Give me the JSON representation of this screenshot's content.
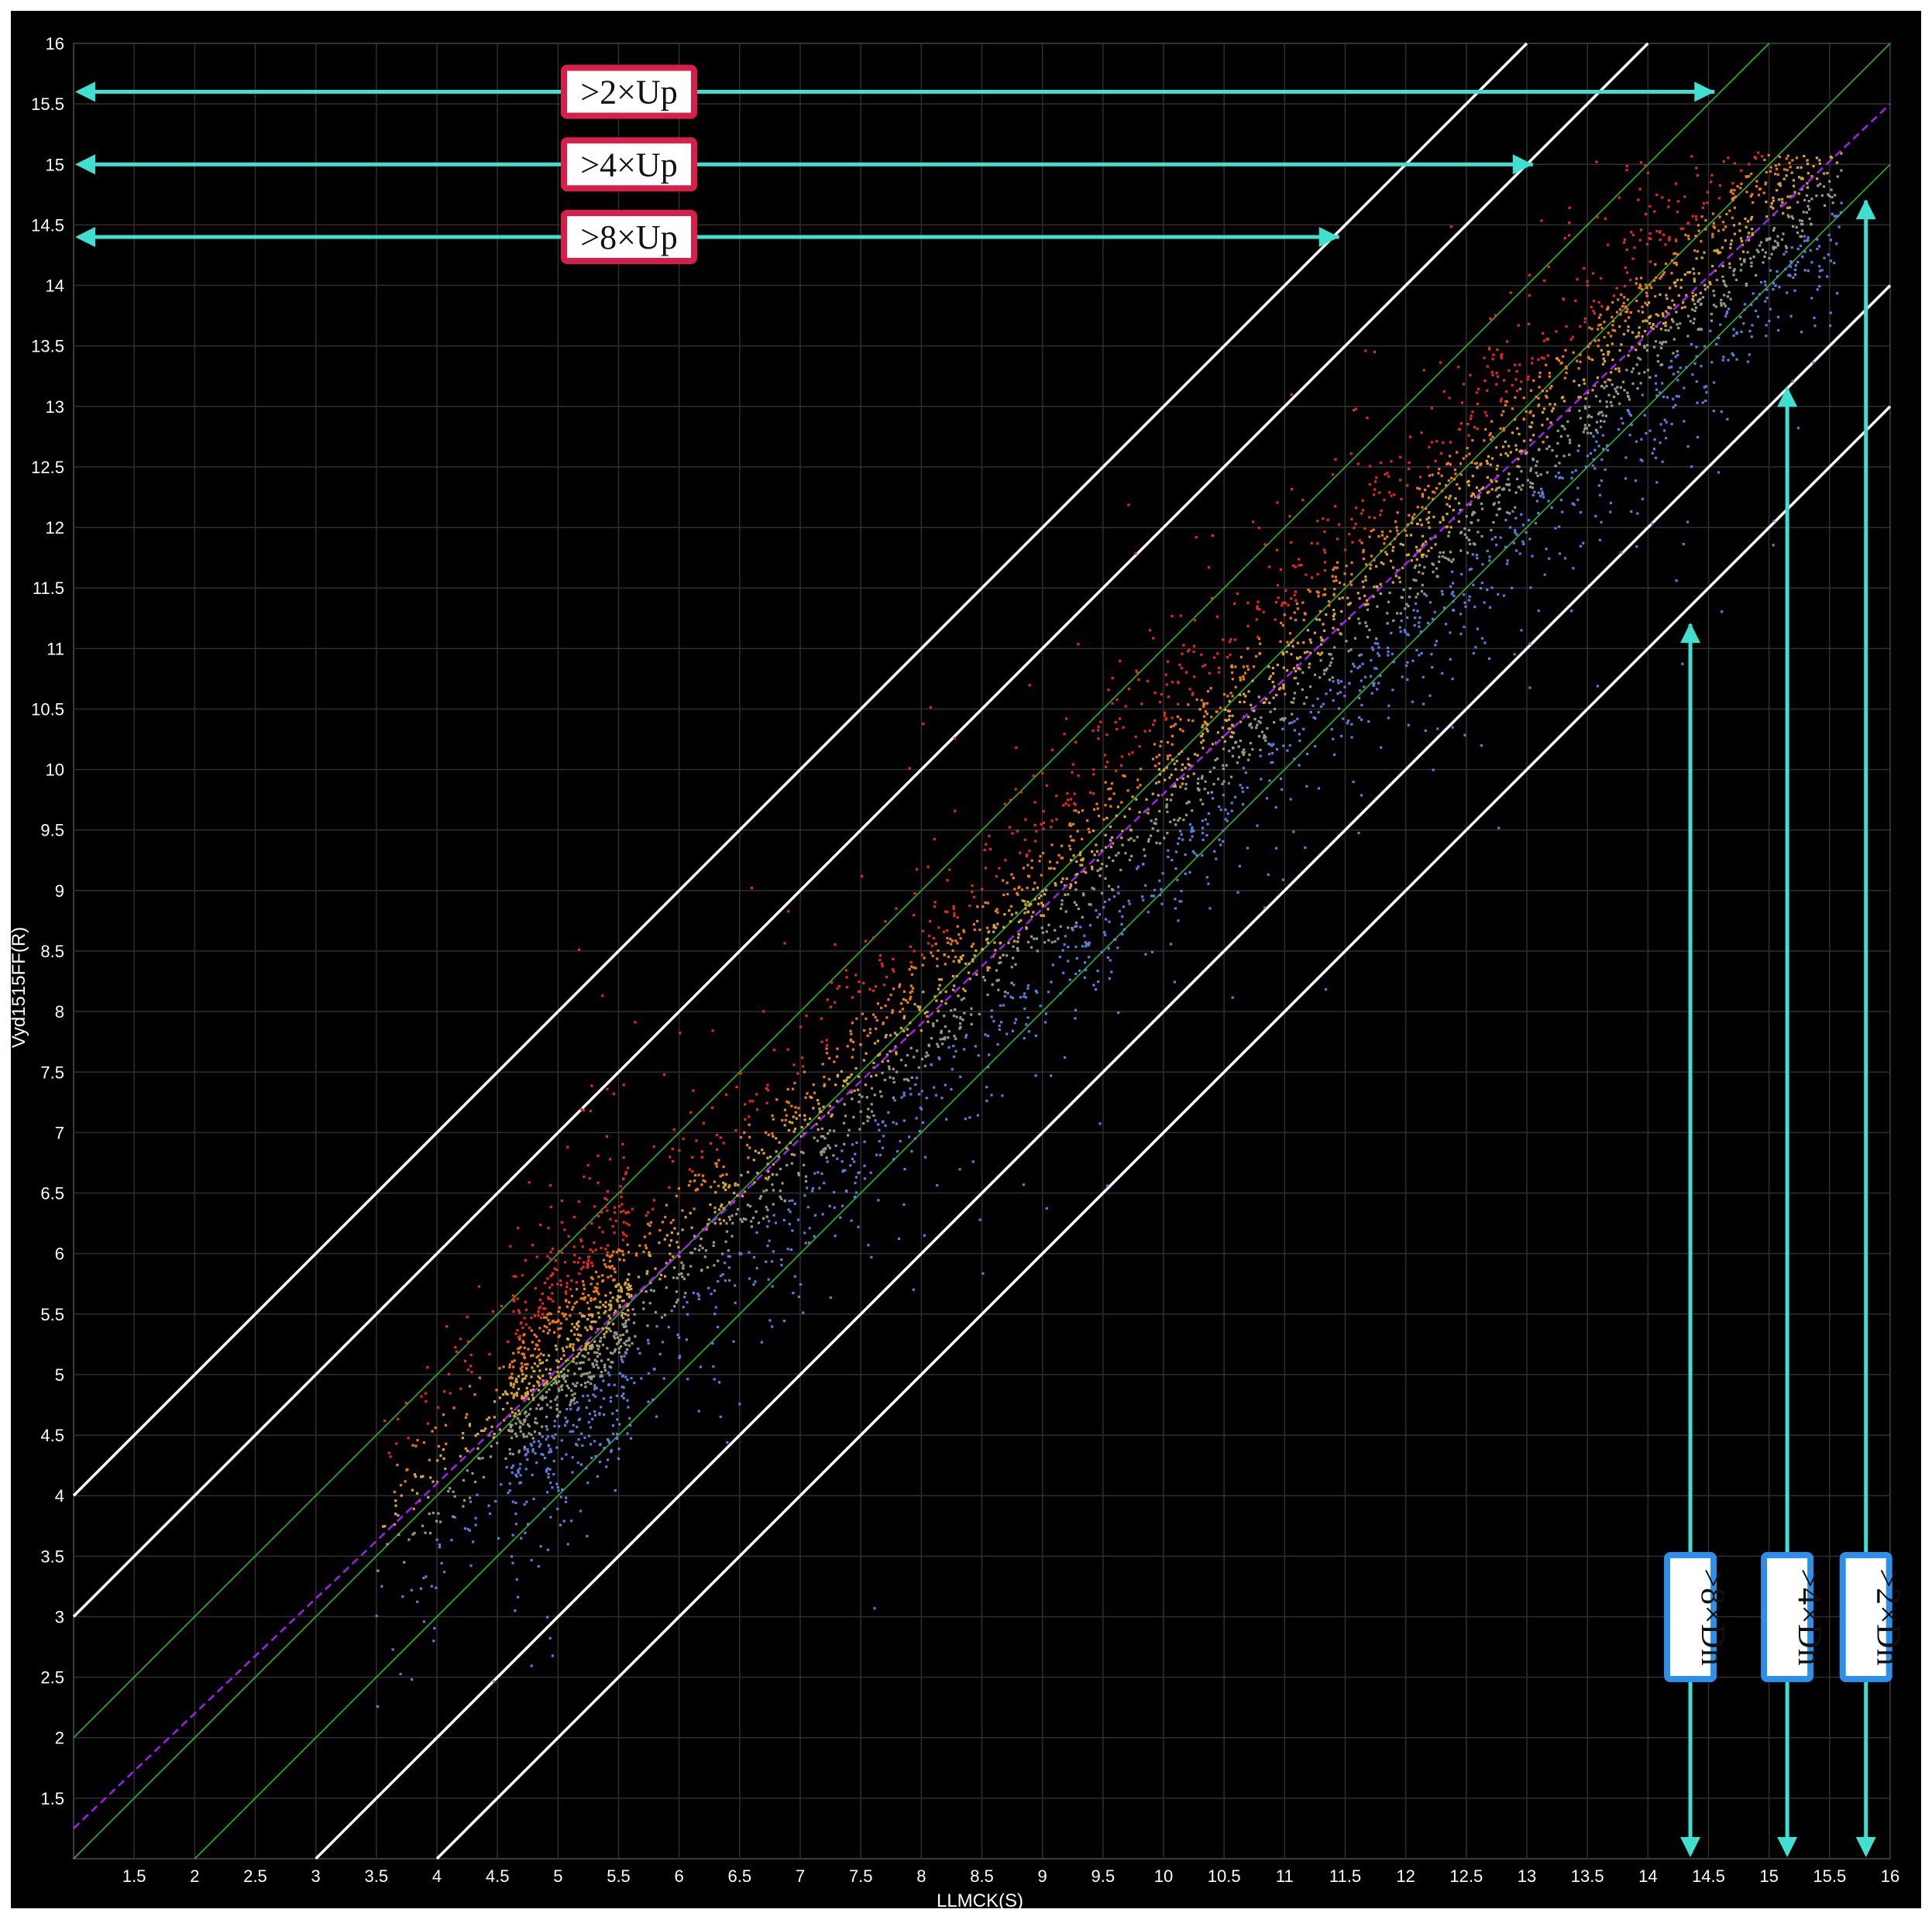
{
  "chart_data": {
    "type": "scatter",
    "title": "",
    "xlabel": "LLMCK(S)",
    "ylabel": "Vyd1515FF(R)",
    "xlim": [
      1,
      16
    ],
    "ylim": [
      1,
      16
    ],
    "x_ticks": [
      "1.5",
      "2",
      "2.5",
      "3",
      "3.5",
      "4",
      "4.5",
      "5",
      "5.5",
      "6",
      "6.5",
      "7",
      "7.5",
      "8",
      "8.5",
      "9",
      "9.5",
      "10",
      "10.5",
      "11",
      "11.5",
      "12",
      "12.5",
      "13",
      "13.5",
      "14",
      "14.5",
      "15",
      "15.5",
      "16"
    ],
    "y_ticks": [
      "1.5",
      "2",
      "2.5",
      "3",
      "3.5",
      "4",
      "4.5",
      "5",
      "5.5",
      "6",
      "6.5",
      "7",
      "7.5",
      "8",
      "8.5",
      "9",
      "9.5",
      "10",
      "10.5",
      "11",
      "11.5",
      "12",
      "12.5",
      "13",
      "13.5",
      "14",
      "14.5",
      "15",
      "15.5",
      "16"
    ],
    "grid": true,
    "background": "#000000",
    "fold_lines": [
      {
        "label": ">2×Up",
        "offset": 1,
        "style": "green-thin"
      },
      {
        "label": ">4×Up",
        "offset": 2,
        "style": "white"
      },
      {
        "label": ">8×Up",
        "offset": 3,
        "style": "white"
      },
      {
        "label": ">2×Dn",
        "offset": -1,
        "style": "green-thin"
      },
      {
        "label": ">4×Dn",
        "offset": -2,
        "style": "white"
      },
      {
        "label": ">8×Dn",
        "offset": -3,
        "style": "white"
      }
    ],
    "trend_line": {
      "color": "#a020f0",
      "style": "dashed",
      "from": [
        1,
        1.25
      ],
      "to": [
        16,
        15.5
      ]
    },
    "point_colors": {
      "up": "#e8281e",
      "up_mid": "#f07a1a",
      "neutral": "#d9a53a",
      "gray": "#9a9a80",
      "down": "#5a7de0"
    },
    "annotations": {
      "up": [
        {
          "text": ">2×Up",
          "y": 15.6,
          "x_end": 14.55
        },
        {
          "text": ">4×Up",
          "y": 15.0,
          "x_end": 13.05
        },
        {
          "text": ">8×Up",
          "y": 14.4,
          "x_end": 11.45
        }
      ],
      "down": [
        {
          "text": ">8×Dn",
          "x": 14.35,
          "y_top": 11.2
        },
        {
          "text": ">4×Dn",
          "x": 15.15,
          "y_top": 13.15
        },
        {
          "text": ">2×Dn",
          "x": 15.8,
          "y_top": 14.7
        }
      ],
      "up_color": "#d81e4a",
      "down_color": "#2e8fe8",
      "arrow_color": "#40e0d0"
    }
  }
}
